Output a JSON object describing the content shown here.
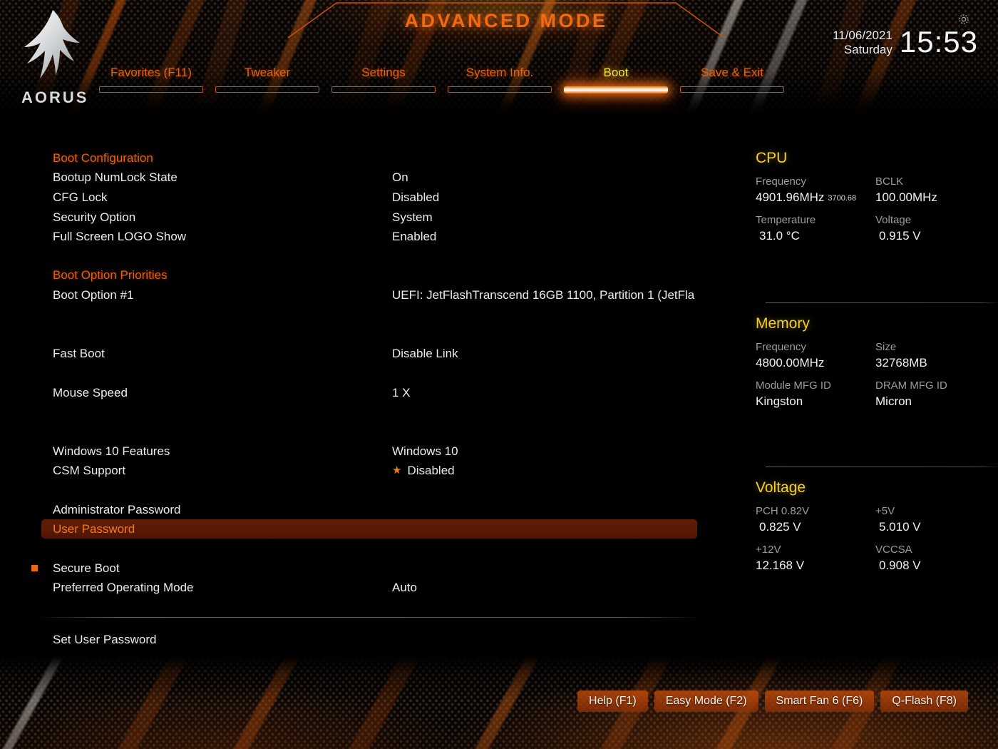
{
  "header": {
    "title": "ADVANCED MODE",
    "brand": "AORUS",
    "date": "11/06/2021",
    "weekday": "Saturday",
    "time": "15:53",
    "gear_icon": "gear-icon",
    "tabs": [
      {
        "label": "Favorites (F11)",
        "active": false
      },
      {
        "label": "Tweaker",
        "active": false
      },
      {
        "label": "Settings",
        "active": false
      },
      {
        "label": "System Info.",
        "active": false
      },
      {
        "label": "Boot",
        "active": true
      },
      {
        "label": "Save & Exit",
        "active": false
      }
    ]
  },
  "settings": {
    "section_boot_config": "Boot Configuration",
    "numlock_label": "Bootup NumLock State",
    "numlock_value": "On",
    "cfglock_label": "CFG Lock",
    "cfglock_value": "Disabled",
    "security_label": "Security Option",
    "security_value": "System",
    "logo_label": "Full Screen LOGO Show",
    "logo_value": "Enabled",
    "section_boot_priorities": "Boot Option Priorities",
    "bootopt1_label": "Boot Option #1",
    "bootopt1_value": "UEFI: JetFlashTranscend 16GB 1100, Partition 1 (JetFla",
    "fastboot_label": "Fast Boot",
    "fastboot_value": "Disable Link",
    "mouse_label": "Mouse Speed",
    "mouse_value": "1 X",
    "win10_label": "Windows 10 Features",
    "win10_value": "Windows 10",
    "csm_label": "CSM Support",
    "csm_value": "Disabled",
    "csm_icon": "star-icon",
    "admin_pw_label": "Administrator Password",
    "user_pw_label": "User Password",
    "secure_boot_label": "Secure Boot",
    "secure_boot_icon": "submenu-bullet-icon",
    "pref_mode_label": "Preferred Operating Mode",
    "pref_mode_value": "Auto",
    "help_text": "Set User Password"
  },
  "sysinfo": {
    "cpu": {
      "title": "CPU",
      "frequency_label": "Frequency",
      "frequency_value": "4901.96MHz",
      "frequency_sub": "3700.68",
      "bclk_label": "BCLK",
      "bclk_value": "100.00MHz",
      "temp_label": "Temperature",
      "temp_value": "31.0 °C",
      "voltage_label": "Voltage",
      "voltage_value": "0.915 V"
    },
    "memory": {
      "title": "Memory",
      "frequency_label": "Frequency",
      "frequency_value": "4800.00MHz",
      "size_label": "Size",
      "size_value": "32768MB",
      "module_mfg_label": "Module MFG ID",
      "module_mfg_value": "Kingston",
      "dram_mfg_label": "DRAM MFG ID",
      "dram_mfg_value": "Micron"
    },
    "voltage": {
      "title": "Voltage",
      "pch_label": "PCH 0.82V",
      "pch_value": "0.825 V",
      "p5v_label": "+5V",
      "p5v_value": "5.010 V",
      "p12v_label": "+12V",
      "p12v_value": "12.168 V",
      "vccsa_label": "VCCSA",
      "vccsa_value": "0.908 V"
    }
  },
  "footer": {
    "buttons": [
      {
        "label": "Help (F1)"
      },
      {
        "label": "Easy Mode (F2)"
      },
      {
        "label": "Smart Fan 6 (F6)"
      },
      {
        "label": "Q-Flash (F8)"
      }
    ]
  },
  "colors": {
    "accent_orange": "#e2640d",
    "active_yellow": "#f2e23c",
    "panel_yellow": "#f5cf1e",
    "highlight_bg": "#5a1a05",
    "highlight_text": "#f37a16",
    "text_primary": "#e9ecee",
    "text_muted": "#9a9d9f"
  }
}
